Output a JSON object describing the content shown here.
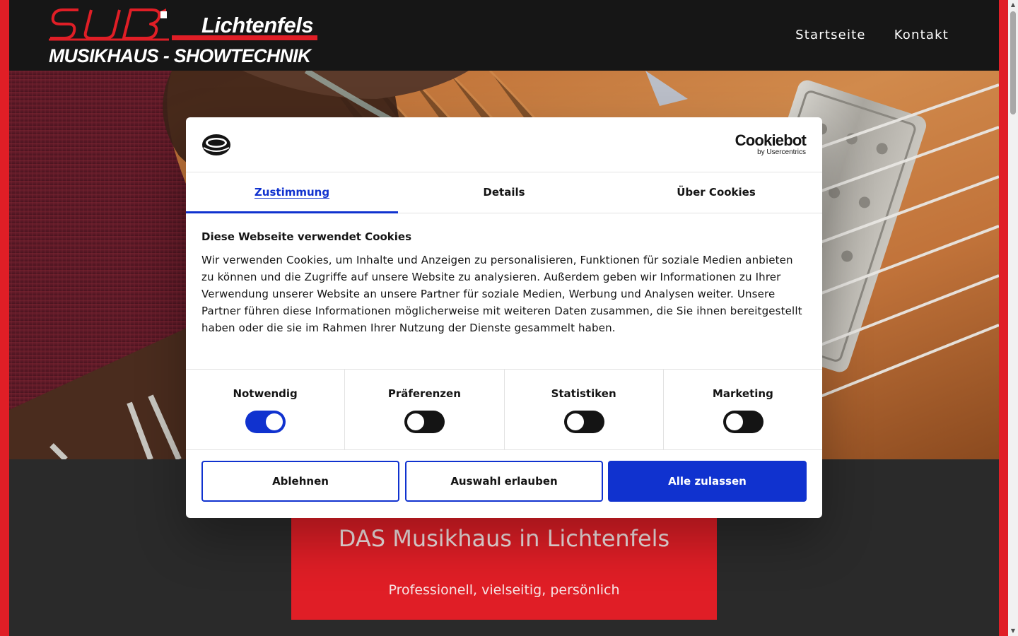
{
  "header": {
    "logo": {
      "brand": "SUB",
      "city": "Lichtenfels",
      "tagline": "MUSIKHAUS - SHOWTECHNIK"
    },
    "nav": [
      {
        "label": "Startseite"
      },
      {
        "label": "Kontakt"
      }
    ]
  },
  "hero": {
    "image": "guitar-closeup"
  },
  "intro": {
    "title": "DAS Musikhaus in Lichtenfels",
    "subtitle": "Professionell, vielseitig, persönlich"
  },
  "cookie_dialog": {
    "brand_main": "Cookiebot",
    "brand_sub": "by Usercentrics",
    "tabs": [
      {
        "label": "Zustimmung",
        "active": true
      },
      {
        "label": "Details",
        "active": false
      },
      {
        "label": "Über Cookies",
        "active": false
      }
    ],
    "title": "Diese Webseite verwendet Cookies",
    "text": "Wir verwenden Cookies, um Inhalte und Anzeigen zu personalisieren, Funktionen für soziale Medien anbieten zu können und die Zugriffe auf unsere Website zu analysieren. Außerdem geben wir Informationen zu Ihrer Verwendung unserer Website an unsere Partner für soziale Medien, Werbung und Analysen weiter. Unsere Partner führen diese Informationen möglicherweise mit weiteren Daten zusammen, die Sie ihnen bereitgestellt haben oder die sie im Rahmen Ihrer Nutzung der Dienste gesammelt haben.",
    "categories": [
      {
        "label": "Notwendig",
        "checked": true
      },
      {
        "label": "Präferenzen",
        "checked": false
      },
      {
        "label": "Statistiken",
        "checked": false
      },
      {
        "label": "Marketing",
        "checked": false
      }
    ],
    "buttons": {
      "deny": "Ablehnen",
      "allow_selection": "Auswahl erlauben",
      "allow_all": "Alle zulassen"
    }
  },
  "colors": {
    "brand_red": "#e01e26",
    "header_bg": "#161616",
    "page_bg": "#2a2a2a",
    "cookiebot_blue": "#1032cf"
  }
}
